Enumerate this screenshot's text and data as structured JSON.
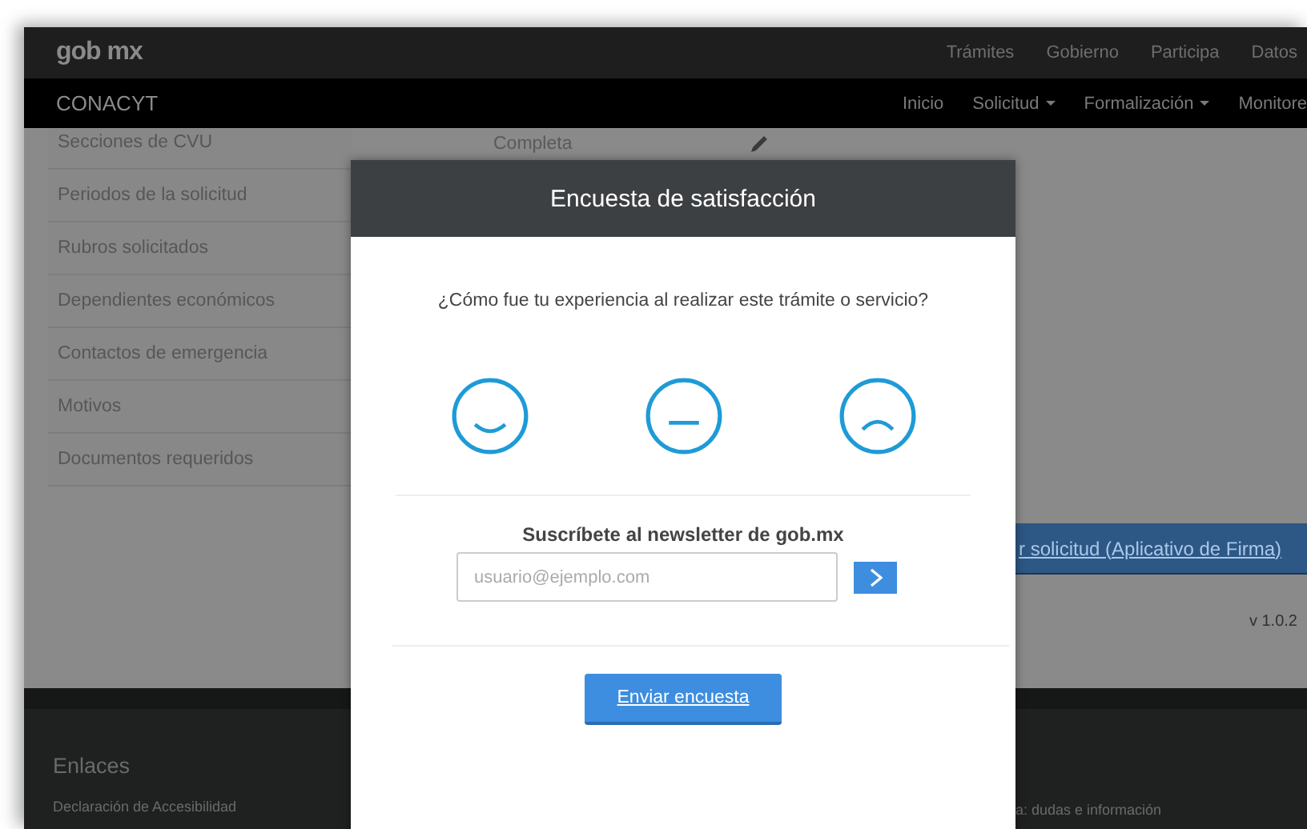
{
  "top_bar": {
    "logo": "gob mx",
    "links": [
      "Trámites",
      "Gobierno",
      "Participa",
      "Datos"
    ]
  },
  "nav_bar": {
    "title": "CONACYT",
    "items": [
      {
        "label": "Inicio",
        "dropdown": false
      },
      {
        "label": "Solicitud",
        "dropdown": true
      },
      {
        "label": "Formalización",
        "dropdown": true
      },
      {
        "label": "Monitore",
        "dropdown": false
      }
    ]
  },
  "sidebar": {
    "items": [
      "Secciones de CVU",
      "Periodos de la solicitud",
      "Rubros solicitados",
      "Dependientes económicos",
      "Contactos de emergencia",
      "Motivos",
      "Documentos requeridos"
    ]
  },
  "main": {
    "status": "Completa",
    "action_button": "r solicitud (Aplicativo de Firma)",
    "version": "v 1.0.2"
  },
  "footer": {
    "heading": "Enlaces",
    "links": [
      "Declaración de Accesibilidad"
    ],
    "contact_text": "a: dudas e información"
  },
  "modal": {
    "title": "Encuesta de satisfacción",
    "question": "¿Cómo fue tu experiencia al realizar este trámite o servicio?",
    "faces": [
      {
        "kind": "happy"
      },
      {
        "kind": "neutral"
      },
      {
        "kind": "sad"
      }
    ],
    "newsletter_title": "Suscríbete al newsletter de gob.mx",
    "email": {
      "placeholder": "usuario@ejemplo.com"
    },
    "submit_button": "Enviar encuesta"
  }
}
